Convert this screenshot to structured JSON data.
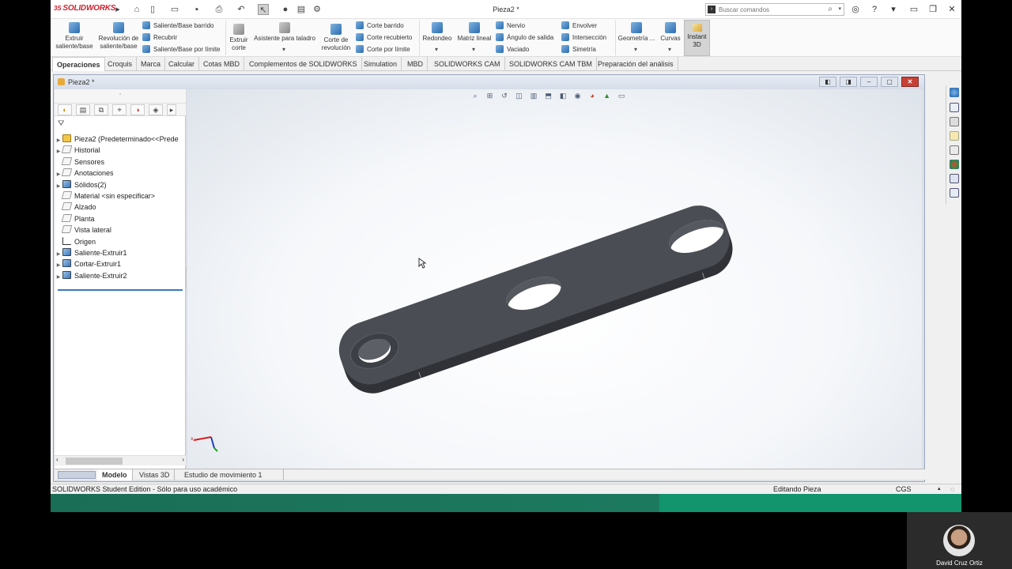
{
  "app": {
    "logo": "SOLIDWORKS",
    "logo_prefix": "3S",
    "doc_title": "Pieza2 *"
  },
  "search": {
    "placeholder": "Buscar comandos",
    "icon": "search-icon"
  },
  "ribbon": {
    "extrude_boss": "Extruir saliente/base",
    "revolve_boss": "Revolución de saliente/base",
    "swept_boss": "Saliente/Base barrido",
    "lofted_boss": "Recubrir",
    "boundary_boss": "Saliente/Base por límite",
    "extruded_cut": "Extruir corte",
    "hole_wizard": "Asistente para taladro",
    "revolved_cut": "Corte de revolución",
    "swept_cut": "Corte barrido",
    "lofted_cut": "Corte recubierto",
    "boundary_cut": "Corte por límite",
    "fillet": "Redondeo",
    "linear_pattern": "Matriz lineal",
    "rib": "Nervio",
    "draft": "Ángulo de salida",
    "shell": "Vaciado",
    "wrap": "Envolver",
    "intersect": "Intersección",
    "mirror": "Simetría",
    "ref_geometry": "Geometría ...",
    "curves": "Curvas",
    "instant3d": "Instant 3D"
  },
  "tabs": [
    "Operaciones",
    "Croquis",
    "Marca",
    "Calcular",
    "Cotas MBD",
    "Complementos de SOLIDWORKS",
    "Simulation",
    "MBD",
    "SOLIDWORKS CAM",
    "SOLIDWORKS CAM TBM",
    "Preparación del análisis"
  ],
  "docwindow": {
    "title": "Pieza2 *"
  },
  "tree": [
    {
      "label": "Pieza2  (Predeterminado<<Prede",
      "expand": true
    },
    {
      "label": "Historial",
      "expand": true
    },
    {
      "label": "Sensores",
      "expand": false
    },
    {
      "label": "Anotaciones",
      "expand": true
    },
    {
      "label": "Sólidos(2)",
      "expand": true
    },
    {
      "label": "Material <sin especificar>",
      "expand": false
    },
    {
      "label": "Alzado",
      "expand": false
    },
    {
      "label": "Planta",
      "expand": false
    },
    {
      "label": "Vista lateral",
      "expand": false
    },
    {
      "label": "Origen",
      "expand": false
    },
    {
      "label": "Saliente-Extruir1",
      "expand": true
    },
    {
      "label": "Cortar-Extruir1",
      "expand": true
    },
    {
      "label": "Saliente-Extruir2",
      "expand": true
    }
  ],
  "bottom_tabs": [
    "Modelo",
    "Vistas 3D",
    "Estudio de movimiento 1"
  ],
  "status": {
    "left": "SOLIDWORKS Student Edition - Sólo para uso académico",
    "mode": "Editando Pieza",
    "units": "CGS"
  },
  "webcam": {
    "name": "David Cruz Ortiz"
  },
  "colors": {
    "part": "#46494f",
    "accent": "#d0202e",
    "close_btn": "#c84035"
  }
}
